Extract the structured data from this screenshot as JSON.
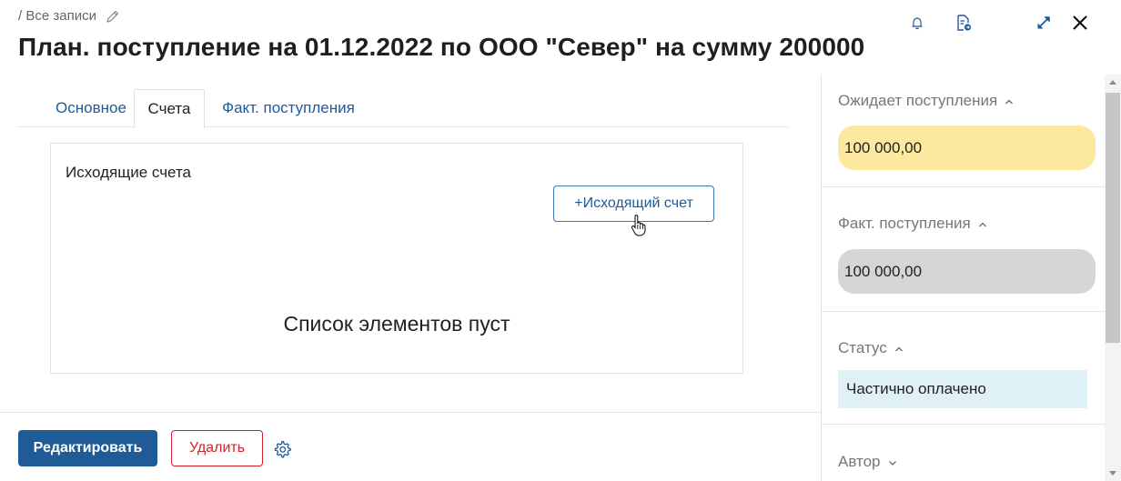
{
  "breadcrumb": {
    "label": "/ Все записи"
  },
  "title": "План. поступление на 01.12.2022 по ООО \"Север\" на сумму 200000",
  "top_icons": [
    "bell-icon",
    "document-export-icon",
    "expand-icon",
    "close-icon"
  ],
  "tabs": [
    {
      "label": "Основное"
    },
    {
      "label": "Счета",
      "active": true
    },
    {
      "label": "Факт. поступления"
    }
  ],
  "card": {
    "title": "Исходящие счета",
    "add_button": "+Исходящий счет",
    "empty_text": "Список элементов пуст"
  },
  "footer": {
    "edit_label": "Редактировать",
    "delete_label": "Удалить"
  },
  "sidebar": {
    "expected": {
      "label": "Ожидает поступления",
      "value": "100 000,00"
    },
    "actual": {
      "label": "Факт. поступления",
      "value": "100 000,00"
    },
    "status": {
      "label": "Статус",
      "value": "Частично оплачено"
    },
    "author": {
      "label": "Автор"
    }
  },
  "colors": {
    "primary": "#1f5b97",
    "link": "#1e5a9a",
    "danger": "#d2232a",
    "expected_bg": "#fde89f",
    "actual_bg": "#d6d6d6",
    "status_bg": "#dff0f7"
  }
}
